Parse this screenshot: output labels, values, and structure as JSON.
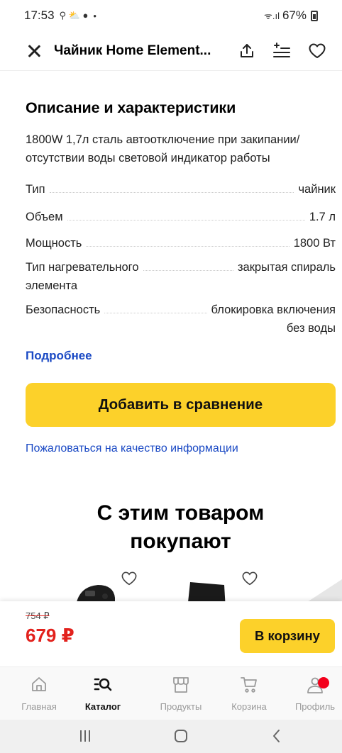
{
  "status_bar": {
    "time": "17:53",
    "left_icons": "⚲ ⛅ ●",
    "dot": "•",
    "right_icons": "ᯤ.ıl",
    "battery": "67%"
  },
  "header": {
    "title": "Чайник Home Element..."
  },
  "specs_section": {
    "title": "Описание и характеристики",
    "description": "1800W 1,7л сталь автоотключение при закипании/ отсутствии воды световой индикатор работы",
    "rows": [
      {
        "label": "Тип",
        "value": "чайник"
      },
      {
        "label": "Объем",
        "value": "1.7 л"
      },
      {
        "label": "Мощность",
        "value": "1800 Вт"
      },
      {
        "label": "Тип нагревательного",
        "label2": "элемента",
        "value": "закрытая спираль"
      },
      {
        "label": "Безопасность",
        "value": "блокировка включения",
        "value2": "без воды"
      }
    ],
    "more_link": "Подробнее",
    "compare_button": "Добавить в сравнение",
    "complain_link": "Пожаловаться на качество информации"
  },
  "related": {
    "title_line1": "С этим товаром",
    "title_line2": "покупают"
  },
  "buy_bar": {
    "old_price": "754 ₽",
    "price": "679 ₽",
    "cart_button": "В корзину"
  },
  "bottom_nav": {
    "items": [
      {
        "label": "Главная",
        "icon": "home-icon"
      },
      {
        "label": "Каталог",
        "icon": "catalog-search-icon"
      },
      {
        "label": "Продукты",
        "icon": "store-icon"
      },
      {
        "label": "Корзина",
        "icon": "cart-icon"
      },
      {
        "label": "Профиль",
        "icon": "profile-icon"
      }
    ]
  },
  "colors": {
    "accent_yellow": "#fcd12a",
    "link_blue": "#1a49c4",
    "price_red": "#e2211c"
  }
}
